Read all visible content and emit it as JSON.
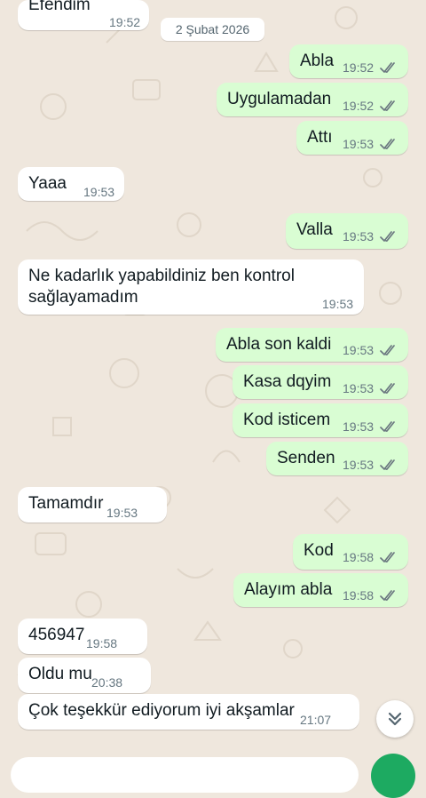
{
  "date_separator": "2 Şubat 2026",
  "messages": [
    {
      "id": "m0",
      "dir": "in",
      "text": "Efendim",
      "time": "19:52"
    },
    {
      "id": "m1",
      "dir": "out",
      "text": "Abla",
      "time": "19:52"
    },
    {
      "id": "m2",
      "dir": "out",
      "text": "Uygulamadan",
      "time": "19:52"
    },
    {
      "id": "m3",
      "dir": "out",
      "text": "Attı",
      "time": "19:53"
    },
    {
      "id": "m4",
      "dir": "in",
      "text": "Yaaa",
      "time": "19:53"
    },
    {
      "id": "m5",
      "dir": "out",
      "text": "Valla",
      "time": "19:53"
    },
    {
      "id": "m6",
      "dir": "in",
      "text": "Ne kadarlık yapabildiniz ben kontrol sağlayamadım",
      "time": "19:53"
    },
    {
      "id": "m7",
      "dir": "out",
      "text": "Abla son kaldi",
      "time": "19:53"
    },
    {
      "id": "m8",
      "dir": "out",
      "text": "Kasa dqyim",
      "time": "19:53"
    },
    {
      "id": "m9",
      "dir": "out",
      "text": "Kod isticem",
      "time": "19:53"
    },
    {
      "id": "m10",
      "dir": "out",
      "text": "Senden",
      "time": "19:53"
    },
    {
      "id": "m11",
      "dir": "in",
      "text": "Tamamdır",
      "time": "19:53"
    },
    {
      "id": "m12",
      "dir": "out",
      "text": "Kod",
      "time": "19:58"
    },
    {
      "id": "m13",
      "dir": "out",
      "text": "Alayım abla",
      "time": "19:58"
    },
    {
      "id": "m14",
      "dir": "in",
      "text": "456947",
      "time": "19:58"
    },
    {
      "id": "m15",
      "dir": "in",
      "text": "Oldu mu",
      "time": "20:38"
    },
    {
      "id": "m16",
      "dir": "in",
      "text": "Çok teşekkür ediyorum iyi akşamlar",
      "time": "21:07"
    }
  ],
  "icons": {
    "read_receipt": "double-check-icon",
    "scroll_down": "double-chevron-down-icon",
    "mic": "mic-icon"
  },
  "colors": {
    "incoming_bubble": "#ffffff",
    "outgoing_bubble": "#d9fdd3",
    "read_tick": "#53bdeb",
    "wallpaper": "#efe7dd",
    "accent": "#1daa61"
  }
}
